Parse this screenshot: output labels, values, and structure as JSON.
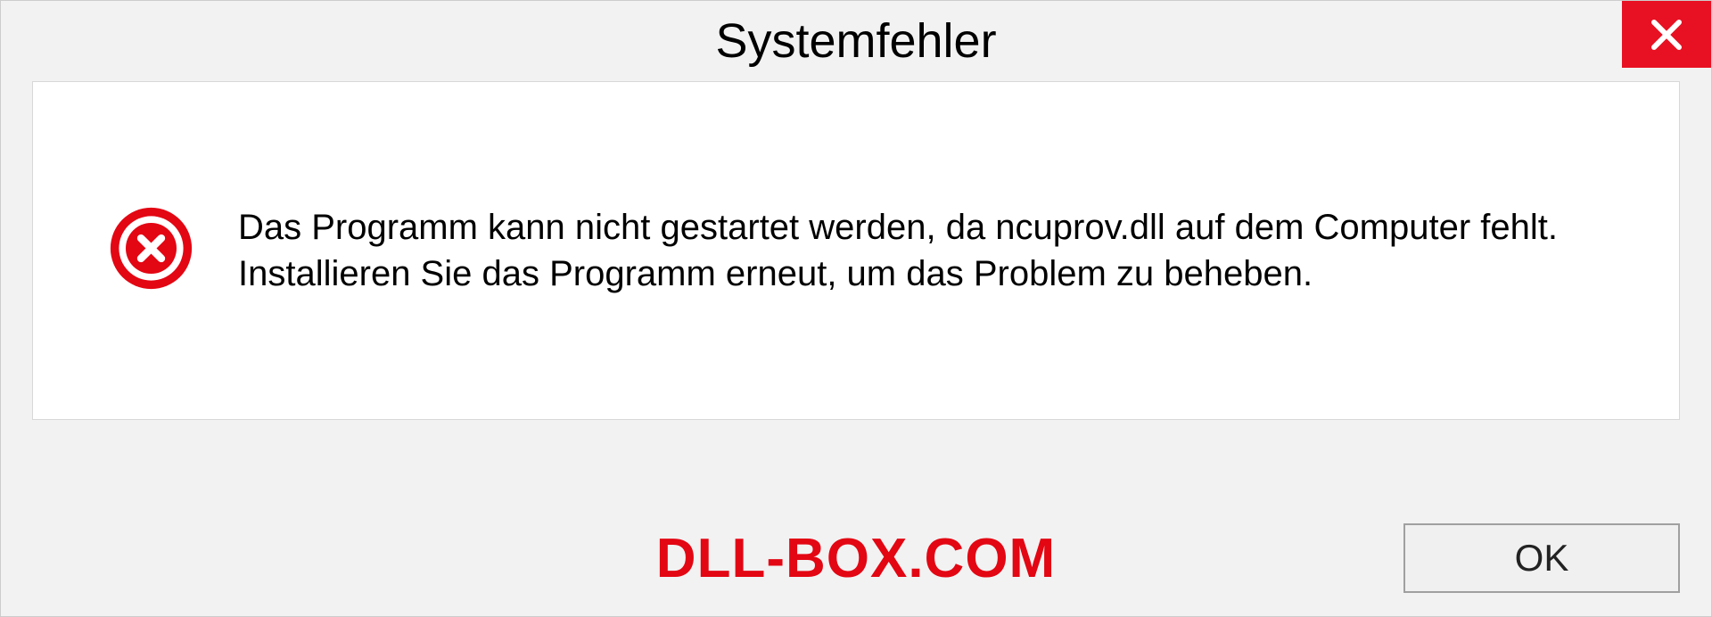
{
  "dialog": {
    "title": "Systemfehler",
    "message": "Das Programm kann nicht gestartet werden, da ncuprov.dll auf dem Computer fehlt. Installieren Sie das Programm erneut, um das Problem zu beheben.",
    "ok_label": "OK",
    "watermark": "DLL-BOX.COM"
  },
  "colors": {
    "close_bg": "#e81123",
    "error_red": "#e30613",
    "watermark_red": "#e30613"
  }
}
